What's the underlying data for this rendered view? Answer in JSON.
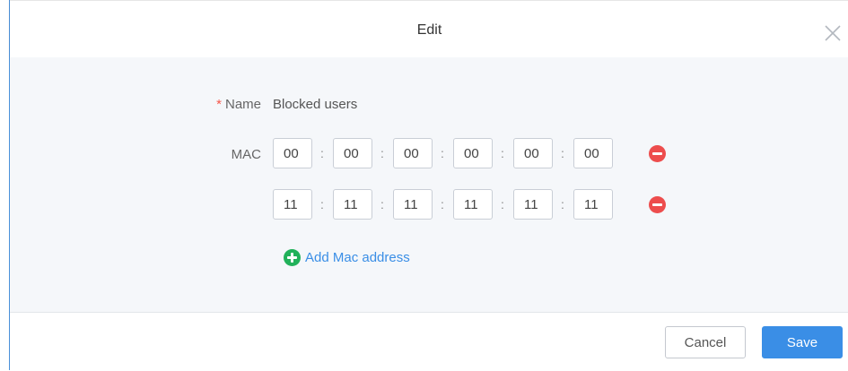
{
  "dialog": {
    "title": "Edit",
    "close_icon": "close-icon"
  },
  "form": {
    "name": {
      "required_mark": "*",
      "label": "Name",
      "value": "Blocked users"
    },
    "mac": {
      "label": "MAC",
      "separator": ":",
      "remove_icon": "minus-circle-icon",
      "addresses": [
        [
          "00",
          "00",
          "00",
          "00",
          "00",
          "00"
        ],
        [
          "11",
          "11",
          "11",
          "11",
          "11",
          "11"
        ]
      ]
    },
    "add": {
      "icon": "plus-circle-icon",
      "label": "Add Mac address"
    }
  },
  "footer": {
    "cancel_label": "Cancel",
    "save_label": "Save"
  },
  "colors": {
    "accent": "#3a8ee6",
    "danger": "#ed4d4d",
    "success": "#21b15a",
    "required": "#f5564a"
  }
}
